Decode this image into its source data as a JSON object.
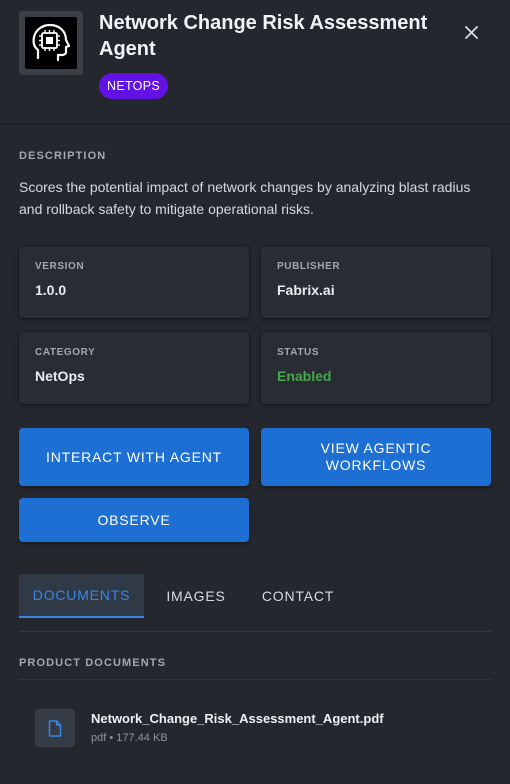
{
  "header": {
    "title": "Network Change Risk Assessment Agent",
    "tag": "NETOPS",
    "logo_icon": "robot-head-chip-icon",
    "close_icon": "close-icon"
  },
  "description": {
    "label": "DESCRIPTION",
    "text": "Scores the potential impact of network changes by analyzing blast radius and rollback safety to mitigate operational risks."
  },
  "info": {
    "version": {
      "label": "VERSION",
      "value": "1.0.0"
    },
    "publisher": {
      "label": "PUBLISHER",
      "value": "Fabrix.ai"
    },
    "category": {
      "label": "CATEGORY",
      "value": "NetOps"
    },
    "status": {
      "label": "STATUS",
      "value": "Enabled"
    }
  },
  "actions": {
    "interact": "INTERACT WITH AGENT",
    "workflows": "VIEW AGENTIC WORKFLOWS",
    "observe": "OBSERVE"
  },
  "tabs": [
    {
      "label": "DOCUMENTS",
      "active": true
    },
    {
      "label": "IMAGES",
      "active": false
    },
    {
      "label": "CONTACT",
      "active": false
    }
  ],
  "documents": {
    "label": "PRODUCT DOCUMENTS",
    "items": [
      {
        "name": "Network_Change_Risk_Assessment_Agent.pdf",
        "type": "pdf",
        "size": "177.44 KB",
        "icon": "file-icon"
      }
    ]
  },
  "colors": {
    "background": "#24282e",
    "accent": "#1e6fd4",
    "tag": "#6312e6",
    "status_enabled": "#43a94a",
    "active_tab": "#3a86e6"
  }
}
